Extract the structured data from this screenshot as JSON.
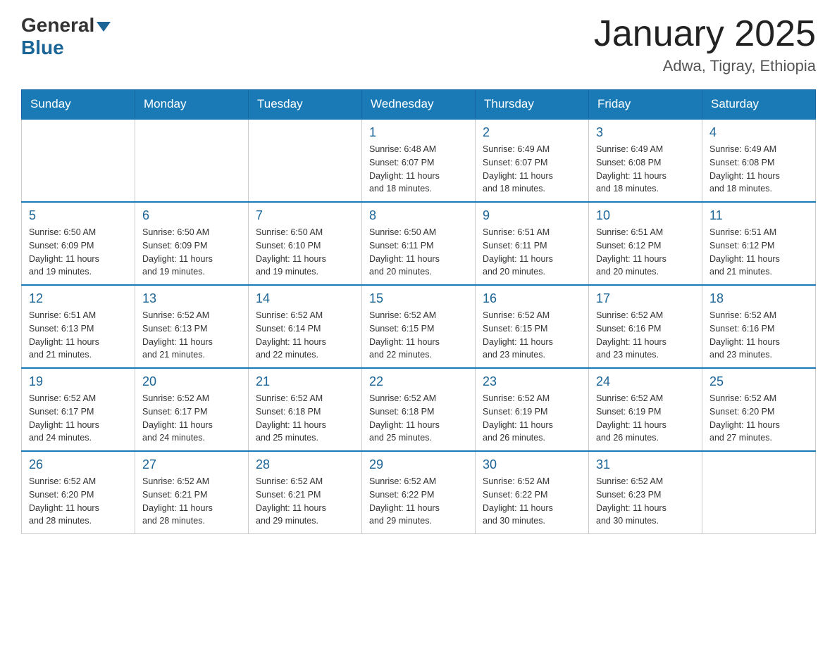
{
  "header": {
    "logo_general": "General",
    "logo_blue": "Blue",
    "month": "January 2025",
    "location": "Adwa, Tigray, Ethiopia"
  },
  "days_of_week": [
    "Sunday",
    "Monday",
    "Tuesday",
    "Wednesday",
    "Thursday",
    "Friday",
    "Saturday"
  ],
  "weeks": [
    [
      {
        "day": "",
        "info": ""
      },
      {
        "day": "",
        "info": ""
      },
      {
        "day": "",
        "info": ""
      },
      {
        "day": "1",
        "info": "Sunrise: 6:48 AM\nSunset: 6:07 PM\nDaylight: 11 hours\nand 18 minutes."
      },
      {
        "day": "2",
        "info": "Sunrise: 6:49 AM\nSunset: 6:07 PM\nDaylight: 11 hours\nand 18 minutes."
      },
      {
        "day": "3",
        "info": "Sunrise: 6:49 AM\nSunset: 6:08 PM\nDaylight: 11 hours\nand 18 minutes."
      },
      {
        "day": "4",
        "info": "Sunrise: 6:49 AM\nSunset: 6:08 PM\nDaylight: 11 hours\nand 18 minutes."
      }
    ],
    [
      {
        "day": "5",
        "info": "Sunrise: 6:50 AM\nSunset: 6:09 PM\nDaylight: 11 hours\nand 19 minutes."
      },
      {
        "day": "6",
        "info": "Sunrise: 6:50 AM\nSunset: 6:09 PM\nDaylight: 11 hours\nand 19 minutes."
      },
      {
        "day": "7",
        "info": "Sunrise: 6:50 AM\nSunset: 6:10 PM\nDaylight: 11 hours\nand 19 minutes."
      },
      {
        "day": "8",
        "info": "Sunrise: 6:50 AM\nSunset: 6:11 PM\nDaylight: 11 hours\nand 20 minutes."
      },
      {
        "day": "9",
        "info": "Sunrise: 6:51 AM\nSunset: 6:11 PM\nDaylight: 11 hours\nand 20 minutes."
      },
      {
        "day": "10",
        "info": "Sunrise: 6:51 AM\nSunset: 6:12 PM\nDaylight: 11 hours\nand 20 minutes."
      },
      {
        "day": "11",
        "info": "Sunrise: 6:51 AM\nSunset: 6:12 PM\nDaylight: 11 hours\nand 21 minutes."
      }
    ],
    [
      {
        "day": "12",
        "info": "Sunrise: 6:51 AM\nSunset: 6:13 PM\nDaylight: 11 hours\nand 21 minutes."
      },
      {
        "day": "13",
        "info": "Sunrise: 6:52 AM\nSunset: 6:13 PM\nDaylight: 11 hours\nand 21 minutes."
      },
      {
        "day": "14",
        "info": "Sunrise: 6:52 AM\nSunset: 6:14 PM\nDaylight: 11 hours\nand 22 minutes."
      },
      {
        "day": "15",
        "info": "Sunrise: 6:52 AM\nSunset: 6:15 PM\nDaylight: 11 hours\nand 22 minutes."
      },
      {
        "day": "16",
        "info": "Sunrise: 6:52 AM\nSunset: 6:15 PM\nDaylight: 11 hours\nand 23 minutes."
      },
      {
        "day": "17",
        "info": "Sunrise: 6:52 AM\nSunset: 6:16 PM\nDaylight: 11 hours\nand 23 minutes."
      },
      {
        "day": "18",
        "info": "Sunrise: 6:52 AM\nSunset: 6:16 PM\nDaylight: 11 hours\nand 23 minutes."
      }
    ],
    [
      {
        "day": "19",
        "info": "Sunrise: 6:52 AM\nSunset: 6:17 PM\nDaylight: 11 hours\nand 24 minutes."
      },
      {
        "day": "20",
        "info": "Sunrise: 6:52 AM\nSunset: 6:17 PM\nDaylight: 11 hours\nand 24 minutes."
      },
      {
        "day": "21",
        "info": "Sunrise: 6:52 AM\nSunset: 6:18 PM\nDaylight: 11 hours\nand 25 minutes."
      },
      {
        "day": "22",
        "info": "Sunrise: 6:52 AM\nSunset: 6:18 PM\nDaylight: 11 hours\nand 25 minutes."
      },
      {
        "day": "23",
        "info": "Sunrise: 6:52 AM\nSunset: 6:19 PM\nDaylight: 11 hours\nand 26 minutes."
      },
      {
        "day": "24",
        "info": "Sunrise: 6:52 AM\nSunset: 6:19 PM\nDaylight: 11 hours\nand 26 minutes."
      },
      {
        "day": "25",
        "info": "Sunrise: 6:52 AM\nSunset: 6:20 PM\nDaylight: 11 hours\nand 27 minutes."
      }
    ],
    [
      {
        "day": "26",
        "info": "Sunrise: 6:52 AM\nSunset: 6:20 PM\nDaylight: 11 hours\nand 28 minutes."
      },
      {
        "day": "27",
        "info": "Sunrise: 6:52 AM\nSunset: 6:21 PM\nDaylight: 11 hours\nand 28 minutes."
      },
      {
        "day": "28",
        "info": "Sunrise: 6:52 AM\nSunset: 6:21 PM\nDaylight: 11 hours\nand 29 minutes."
      },
      {
        "day": "29",
        "info": "Sunrise: 6:52 AM\nSunset: 6:22 PM\nDaylight: 11 hours\nand 29 minutes."
      },
      {
        "day": "30",
        "info": "Sunrise: 6:52 AM\nSunset: 6:22 PM\nDaylight: 11 hours\nand 30 minutes."
      },
      {
        "day": "31",
        "info": "Sunrise: 6:52 AM\nSunset: 6:23 PM\nDaylight: 11 hours\nand 30 minutes."
      },
      {
        "day": "",
        "info": ""
      }
    ]
  ]
}
